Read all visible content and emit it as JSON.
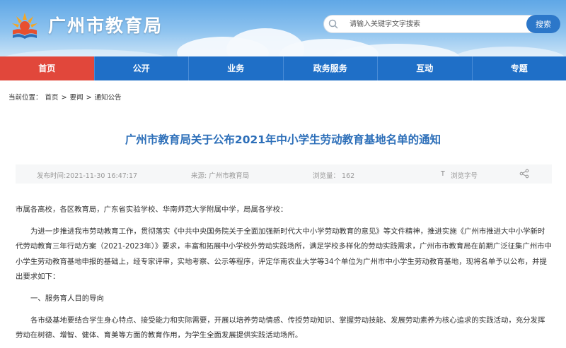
{
  "site": {
    "title": "广州市教育局"
  },
  "search": {
    "placeholder": "请输入关键字文字搜索",
    "button_label": "搜索"
  },
  "nav": {
    "items": [
      "首页",
      "公开",
      "业务",
      "政务服务",
      "互动",
      "专题"
    ],
    "active_index": 0
  },
  "breadcrumb": {
    "prefix": "当前位置：",
    "items": [
      "首页",
      "要闻",
      "通知公告"
    ],
    "separator": ">"
  },
  "article": {
    "title": "广州市教育局关于公布2021年中小学生劳动教育基地名单的通知",
    "publish_time": "发布时间:2021-11-30 16:47:17",
    "source": "来源: 广州市教育局",
    "views": "浏览量： 162",
    "font_toggle_icon": "T",
    "font_toggle_label": "浏览字号",
    "paragraphs": [
      "市属各高校，各区教育局，广东省实验学校、华南师范大学附属中学，局属各学校：",
      "为进一步推进我市劳动教育工作，贯彻落实《中共中央国务院关于全面加强新时代大中小学劳动教育的意见》等文件精神，推进实施《广州市推进大中小学新时代劳动教育三年行动方案（2021-2023年）》要求，丰富和拓展中小学校外劳动实践场所，满足学校多样化的劳动实践需求，广州市市教育局在前期广泛征集广州市中小学生劳动教育基地申报的基础上，经专家评审，实地考察、公示等程序，评定华南农业大学等34个单位为广州市中小学生劳动教育基地，现将名单予以公布，并提出要求如下：",
      "一、服务育人目的导向",
      "各市级基地要结合学生身心特点、接受能力和实际需要，开展以培养劳动情感、传授劳动知识、掌握劳动技能、发展劳动素养为核心追求的实践活动，充分发挥劳动在树德、增智、健体、育美等方面的教育作用，为学生全面发展提供实践活动场所。"
    ]
  },
  "colors": {
    "nav_bg": "#1f6fc7",
    "nav_active": "#e1473b",
    "title": "#2d6fb9",
    "search_button": "#2c77c9"
  },
  "icons": {
    "logo": "education-bureau-logo",
    "search": "search-icon",
    "share": "share-icon"
  }
}
